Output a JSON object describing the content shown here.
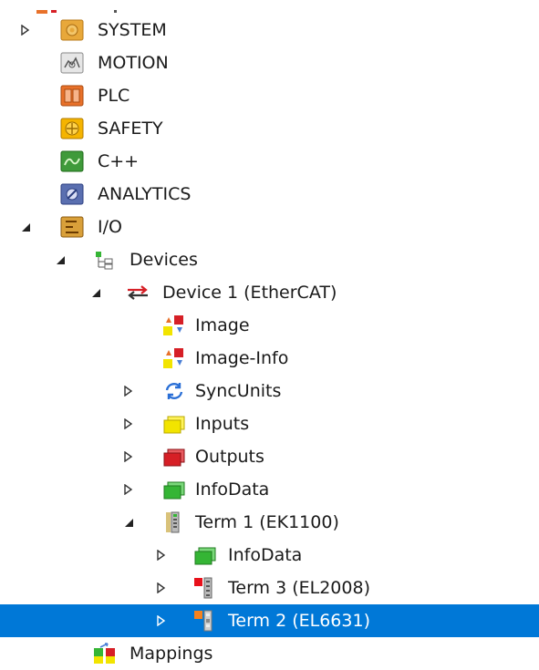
{
  "tree": {
    "items": [
      {
        "label": "SYSTEM"
      },
      {
        "label": "MOTION"
      },
      {
        "label": "PLC"
      },
      {
        "label": "SAFETY"
      },
      {
        "label": "C++"
      },
      {
        "label": "ANALYTICS"
      },
      {
        "label": "I/O"
      },
      {
        "label": "Devices"
      },
      {
        "label": "Device 1 (EtherCAT)"
      },
      {
        "label": "Image"
      },
      {
        "label": "Image-Info"
      },
      {
        "label": "SyncUnits"
      },
      {
        "label": "Inputs"
      },
      {
        "label": "Outputs"
      },
      {
        "label": "InfoData"
      },
      {
        "label": "Term 1 (EK1100)"
      },
      {
        "label": "InfoData"
      },
      {
        "label": "Term 3 (EL2008)"
      },
      {
        "label": "Term 2 (EL6631)"
      },
      {
        "label": "Mappings"
      }
    ],
    "selected_item": "Term 2 (EL6631)"
  },
  "colors": {
    "selection": "#0078d7",
    "system": "#e8a83a",
    "plc": "#e8712a",
    "safety": "#f5b400",
    "cpp": "#3f9a3a",
    "analytics": "#5a6fb0",
    "io": "#d9a03a",
    "inputs": "#f2e400",
    "outputs": "#d61f26",
    "infodata": "#35b535"
  }
}
